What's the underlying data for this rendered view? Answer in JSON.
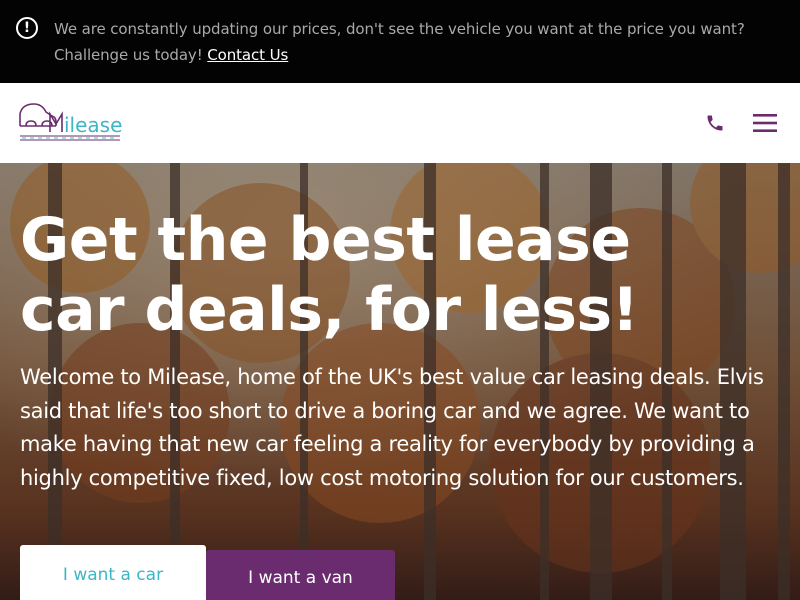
{
  "notice": {
    "icon": "alert-circle-icon",
    "text": "We are constantly updating our prices, don't see the vehicle you want at the price you want? Challenge us today!",
    "link_label": "Contact Us"
  },
  "header": {
    "logo_text": "ilease",
    "icons": [
      "phone-icon",
      "menu-icon"
    ]
  },
  "hero": {
    "title": "Get the best lease car deals, for less!",
    "description": "Welcome to Milease, home of the UK's best value car leasing deals. Elvis said that life's too short to drive a boring car and we agree. We want to make having that new car feeling a reality for everybody by providing a highly competitive fixed, low cost motoring solution for our customers.",
    "tabs": [
      {
        "label": "I want a car",
        "active": true
      },
      {
        "label": "I want a van",
        "active": false
      }
    ]
  },
  "colors": {
    "brand_purple": "#6a2c6f",
    "brand_teal": "#3cb5c5",
    "notice_bg": "#030303"
  }
}
